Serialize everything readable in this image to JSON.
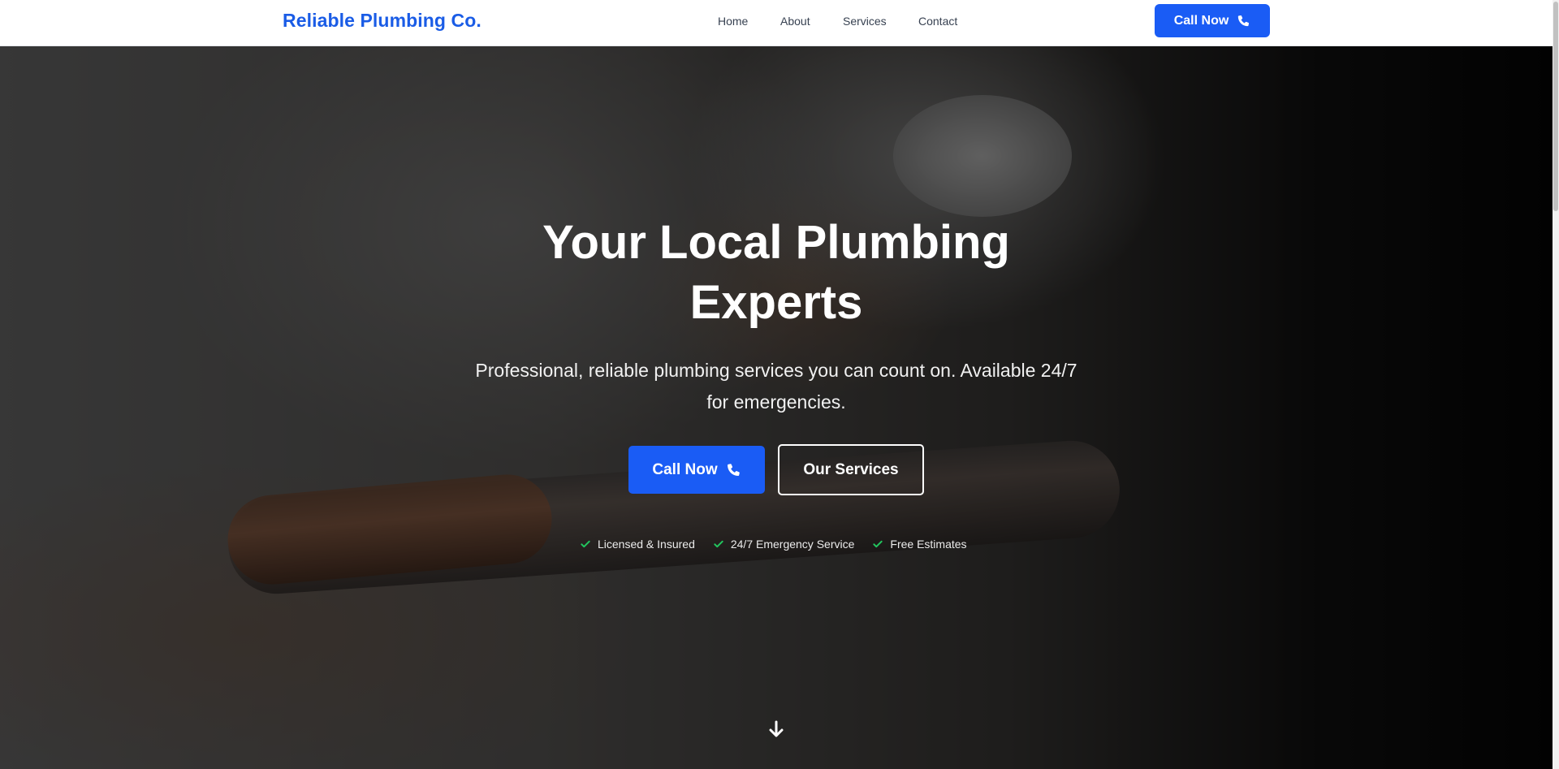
{
  "header": {
    "brand": "Reliable Plumbing Co.",
    "nav": [
      "Home",
      "About",
      "Services",
      "Contact"
    ],
    "cta_label": "Call Now"
  },
  "hero": {
    "title_line1": "Your Local Plumbing",
    "title_line2": "Experts",
    "subtitle": "Professional, reliable plumbing services you can count on. Available 24/7 for emergencies.",
    "primary_button": "Call Now",
    "secondary_button": "Our Services",
    "badges": [
      "Licensed & Insured",
      "24/7 Emergency Service",
      "Free Estimates"
    ]
  },
  "icons": {
    "phone": "phone-icon",
    "check": "check-icon",
    "arrow": "arrow-down-icon"
  },
  "colors": {
    "brand": "#1a5ce6",
    "primary": "#1a5cf5",
    "check": "#22c55e"
  }
}
